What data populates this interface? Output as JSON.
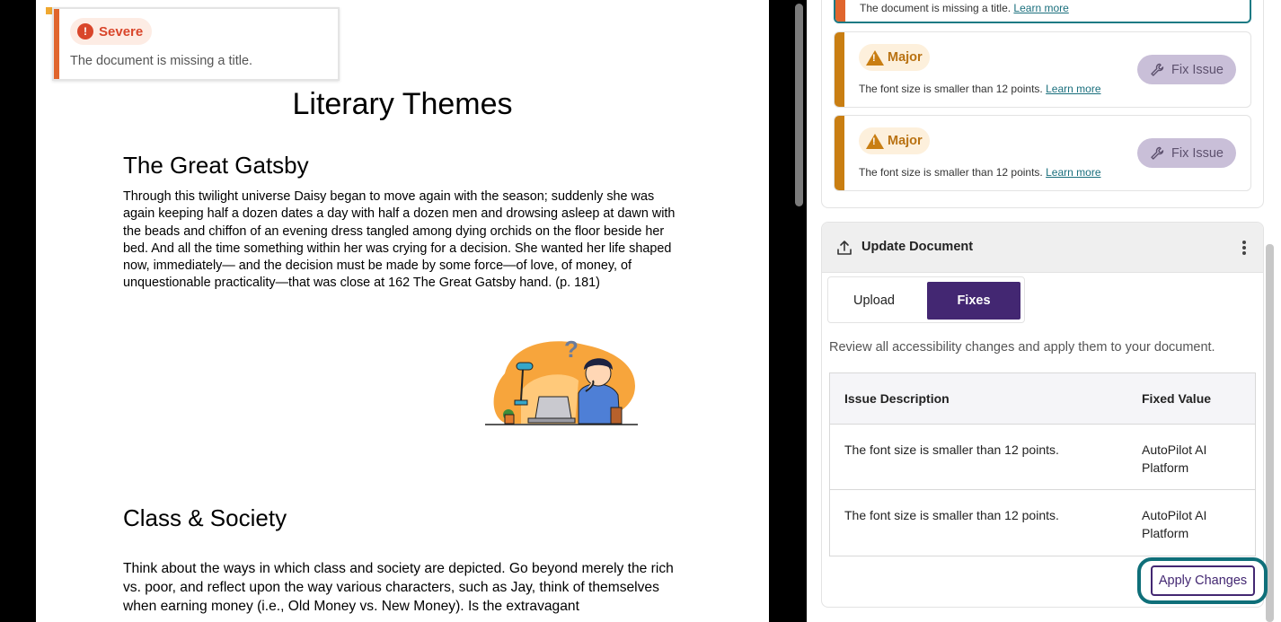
{
  "document": {
    "title": "Literary Themes",
    "section1_heading": "The Great Gatsby",
    "section1_body": "Through this twilight universe Daisy began to move again with the season; suddenly she was again keeping half a dozen dates a day with half a dozen men and drowsing asleep at dawn with the beads and chiffon of an evening dress tangled among dying orchids on the floor beside her bed. And all the time something within her was crying for a decision. She wanted her life shaped now, immediately— and the decision must be made by some force—of love, of money, of unquestionable practicality—that was close at 162 The Great Gatsby hand. (p. 181)",
    "section2_heading": "Class & Society",
    "section2_body": "Think about the ways in which class and society are depicted. Go beyond merely the rich vs. poor, and reflect upon the way various characters, such as Jay, think of themselves when earning money (i.e., Old Money vs. New Money). Is the extravagant"
  },
  "tooltip": {
    "severity_label": "Severe",
    "message": "The document is missing a title."
  },
  "issues": {
    "first_partial": {
      "message": "The document is missing a title.",
      "link": "Learn more"
    },
    "items": [
      {
        "severity": "Major",
        "message": "The font size is smaller than 12 points.",
        "link": "Learn more",
        "button": "Fix Issue"
      },
      {
        "severity": "Major",
        "message": "The font size is smaller than 12 points.",
        "link": "Learn more",
        "button": "Fix Issue"
      }
    ]
  },
  "update": {
    "title": "Update Document",
    "tabs": [
      "Upload",
      "Fixes"
    ],
    "active_tab": "Fixes",
    "description": "Review all accessibility changes and apply them to your document.",
    "table": {
      "headers": [
        "Issue Description",
        "Fixed Value"
      ],
      "rows": [
        [
          "The font size is smaller than 12 points.",
          "AutoPilot AI Platform"
        ],
        [
          "The font size is smaller than 12 points.",
          "AutoPilot AI Platform"
        ]
      ]
    },
    "apply_button": "Apply Changes"
  },
  "colors": {
    "severe": "#d9462b",
    "major": "#c97e12",
    "primary": "#432772",
    "focus": "#0f6f79"
  }
}
